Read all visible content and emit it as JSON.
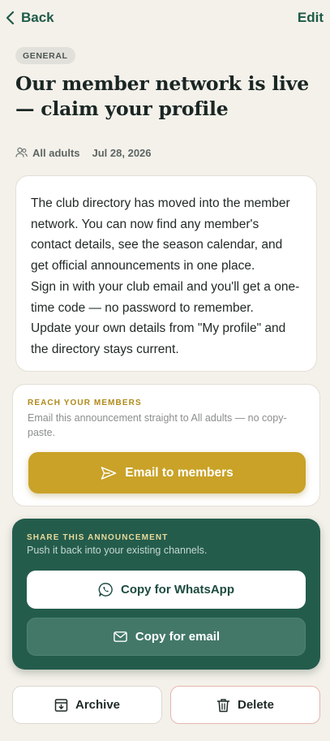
{
  "nav": {
    "back_label": "Back",
    "edit_label": "Edit",
    "back_icon": "chevron-left-icon"
  },
  "post": {
    "category": "GENERAL",
    "title": "Our member network is live — claim your profile",
    "audience": "All adults",
    "date": "Jul 28, 2026",
    "audience_icon": "people-icon",
    "body": [
      "The club directory has moved into the member network. You can now find any member's contact details, see the season calendar, and get official announcements in one place.",
      "Sign in with your club email and you'll get a one-time code — no password to remember.",
      "Update your own details from \"My profile\" and the directory stays current."
    ]
  },
  "reach": {
    "eyebrow": "REACH YOUR MEMBERS",
    "subtitle": "Email this announcement straight to All adults — no copy-paste.",
    "button_label": "Email to members",
    "button_icon": "send-icon"
  },
  "share": {
    "eyebrow": "SHARE THIS ANNOUNCEMENT",
    "subtitle": "Push it back into your existing channels.",
    "whatsapp_label": "Copy for WhatsApp",
    "whatsapp_icon": "whatsapp-icon",
    "email_label": "Copy for email",
    "email_icon": "mail-icon"
  },
  "actions": {
    "archive_label": "Archive",
    "archive_icon": "archive-icon",
    "delete_label": "Delete",
    "delete_icon": "trash-icon"
  },
  "colors": {
    "background": "#f4f1ea",
    "brand_green": "#245c4c",
    "accent_gold": "#c9a227",
    "delete_border": "#e4b6ac"
  }
}
